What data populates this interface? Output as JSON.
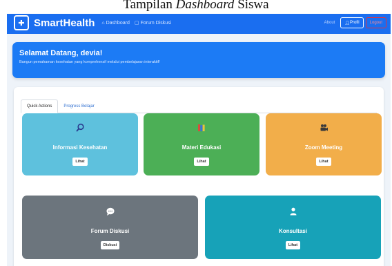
{
  "caption": {
    "normal": "Tampilan ",
    "italic": "Dashboard",
    "end": " Siswa"
  },
  "navbar": {
    "brand": "SmartHealth",
    "brand_icon": "health-house-icon",
    "links": [
      {
        "label": "Dashboard",
        "icon": "home-icon"
      },
      {
        "label": "Forum Diskusi",
        "icon": "chat-icon"
      }
    ],
    "about_label": "About",
    "profil_label": "Profil",
    "logout_label": "Logout"
  },
  "welcome": {
    "title": "Selamat Datang, devia!",
    "subtitle": "Bangun pemahaman kesehatan yang komprehensif melalui pembelajaran interaktif!"
  },
  "tabs": {
    "quick_actions": "Quick Actions",
    "progress": "Progress Belajar"
  },
  "cards": [
    {
      "title": "Informasi Kesehatan",
      "button": "Lihat",
      "icon": "magnifier-icon",
      "color": "#5ec1dd"
    },
    {
      "title": "Materi Edukasi",
      "button": "Lihat",
      "icon": "books-icon",
      "color": "#4caf56"
    },
    {
      "title": "Zoom Meeting",
      "button": "Lihat",
      "icon": "video-camera-icon",
      "color": "#f2ae4a"
    },
    {
      "title": "Forum Diskusi",
      "button": "Diskusi",
      "icon": "speech-bubble-icon",
      "color": "#6c757d"
    },
    {
      "title": "Konsultasi",
      "button": "Lihat",
      "icon": "user-icon",
      "color": "#17a2b8"
    }
  ],
  "colors": {
    "navbar": "#1a6ef0",
    "welcome": "#1c7bf5",
    "logout": "#e03240"
  }
}
